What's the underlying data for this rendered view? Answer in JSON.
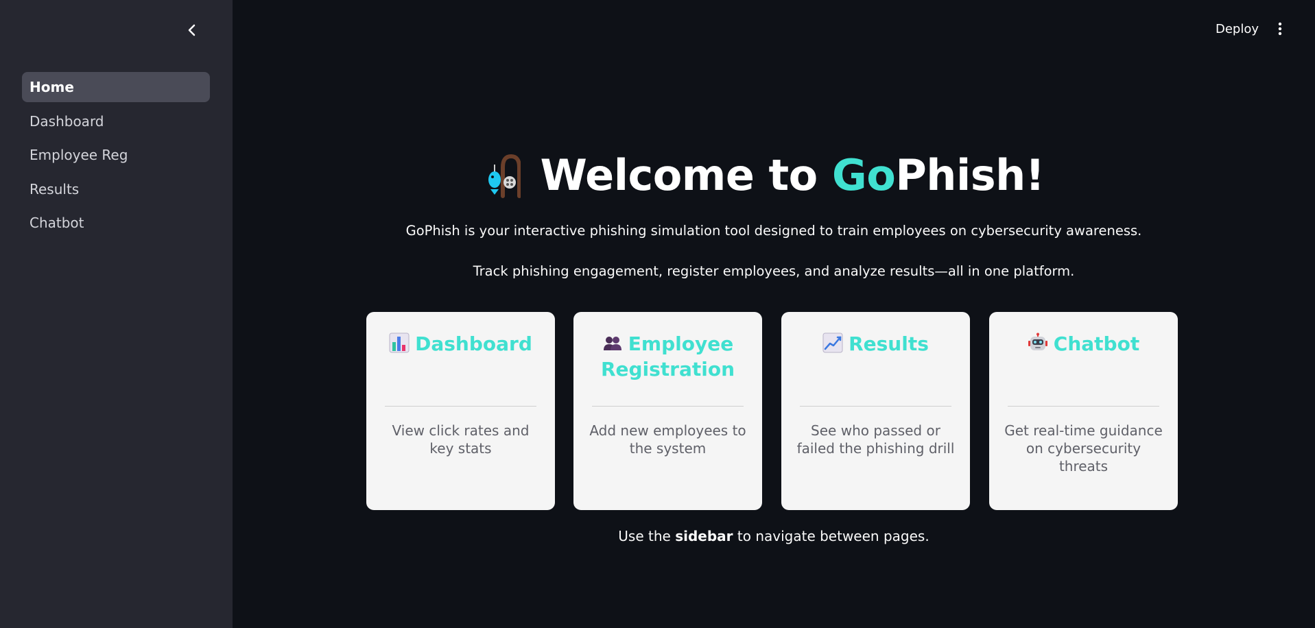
{
  "sidebar": {
    "collapse_icon": "chevron-left-icon",
    "items": [
      {
        "label": "Home",
        "active": true
      },
      {
        "label": "Dashboard",
        "active": false
      },
      {
        "label": "Employee Reg",
        "active": false
      },
      {
        "label": "Results",
        "active": false
      },
      {
        "label": "Chatbot",
        "active": false
      }
    ]
  },
  "header": {
    "deploy_label": "Deploy",
    "menu_icon": "vertical-ellipsis-icon"
  },
  "main": {
    "title_prefix": "Welcome to ",
    "title_highlight": "Go",
    "title_suffix": "Phish!",
    "title_icon": "fishing-pole-icon",
    "subtitle": "GoPhish is your interactive phishing simulation tool designed to train employees on cybersecurity awareness.",
    "subtitle2": "Track phishing engagement, register employees, and analyze results—all in one platform.",
    "cards": [
      {
        "icon": "bar-chart-icon",
        "title": "Dashboard",
        "description": "View click rates and key stats"
      },
      {
        "icon": "people-icon",
        "title": "Employee Registration",
        "description": "Add new employees to the system"
      },
      {
        "icon": "line-chart-icon",
        "title": "Results",
        "description": "See who passed or failed the phishing drill"
      },
      {
        "icon": "robot-icon",
        "title": "Chatbot",
        "description": "Get real-time guidance on cybersecurity threats"
      }
    ],
    "footer_prefix": "Use the ",
    "footer_bold": "sidebar",
    "footer_suffix": " to navigate between pages."
  },
  "colors": {
    "background": "#0e1117",
    "sidebar": "#262730",
    "accent": "#40e0d0",
    "card": "#f5f5f5"
  }
}
